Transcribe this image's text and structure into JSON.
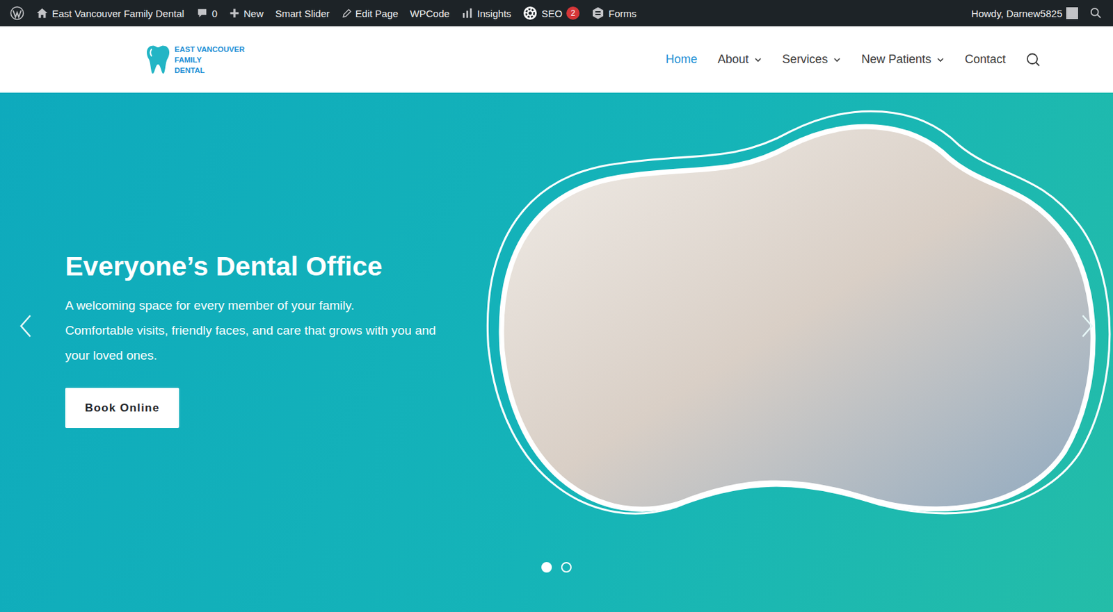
{
  "adminbar": {
    "items": [
      {
        "kind": "site",
        "label": "East Vancouver Family Dental"
      },
      {
        "kind": "comments",
        "label": "0"
      },
      {
        "kind": "new",
        "label": "New"
      },
      {
        "kind": "plain",
        "label": "Smart Slider"
      },
      {
        "kind": "edit",
        "label": "Edit Page"
      },
      {
        "kind": "plain",
        "label": "WPCode"
      },
      {
        "kind": "insights",
        "label": "Insights"
      },
      {
        "kind": "seo",
        "label": "SEO",
        "badge": "2"
      },
      {
        "kind": "forms",
        "label": "Forms"
      }
    ],
    "account": "Howdy, Darnew5825"
  },
  "logo": {
    "lines": [
      "EAST VANCOUVER",
      "FAMILY",
      "DENTAL"
    ]
  },
  "nav": [
    {
      "label": "Home",
      "selected": true,
      "dropdown": false
    },
    {
      "label": "About",
      "selected": false,
      "dropdown": true
    },
    {
      "label": "Services",
      "selected": false,
      "dropdown": true
    },
    {
      "label": "New Patients",
      "selected": false,
      "dropdown": true
    },
    {
      "label": "Contact",
      "selected": false,
      "dropdown": false
    }
  ],
  "hero": {
    "title": "Everyone’s Dental Office",
    "lines": [
      "A welcoming space for every member of your family.",
      "Comfortable visits, friendly faces, and care that grows with you and",
      "your loved ones."
    ],
    "button": "Book Online",
    "slides": [
      {
        "selected": true
      },
      {
        "selected": false
      }
    ]
  }
}
